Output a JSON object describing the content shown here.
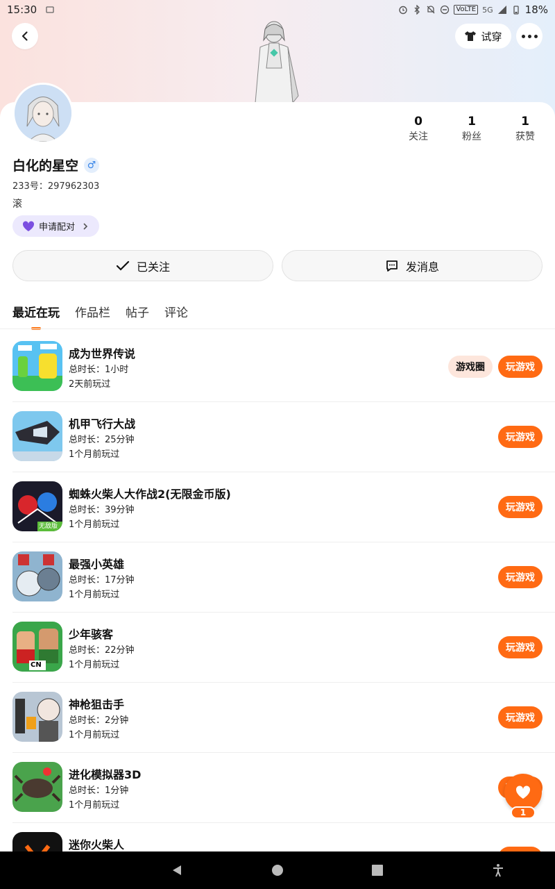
{
  "status_bar": {
    "time": "15:30",
    "network": "5G",
    "volte": "VoLTE",
    "battery": "18%"
  },
  "header": {
    "tryon_label": "试穿"
  },
  "profile": {
    "name": "白化的星空",
    "gender_symbol": "♂",
    "uid": "233号：297962303",
    "bio": "滚",
    "match_label": "申请配对",
    "stats": [
      {
        "value": "0",
        "label": "关注"
      },
      {
        "value": "1",
        "label": "粉丝"
      },
      {
        "value": "1",
        "label": "获赞"
      }
    ]
  },
  "actions": {
    "follow_label": "已关注",
    "message_label": "发消息"
  },
  "tabs": [
    "最近在玩",
    "作品栏",
    "帖子",
    "评论"
  ],
  "games": [
    {
      "title": "成为世界传说",
      "duration": "总时长：1小时",
      "last": "2天前玩过",
      "circle": "游戏圈",
      "play": "玩游戏"
    },
    {
      "title": "机甲飞行大战",
      "duration": "总时长：25分钟",
      "last": "1个月前玩过",
      "play": "玩游戏"
    },
    {
      "title": "蜘蛛火柴人大作战2(无限金币版)",
      "duration": "总时长：39分钟",
      "last": "1个月前玩过",
      "play": "玩游戏",
      "icon_badge": "无敌版"
    },
    {
      "title": "最强小英雄",
      "duration": "总时长：17分钟",
      "last": "1个月前玩过",
      "play": "玩游戏"
    },
    {
      "title": "少年骇客",
      "duration": "总时长：22分钟",
      "last": "1个月前玩过",
      "play": "玩游戏",
      "icon_badge": "CN"
    },
    {
      "title": "神枪狙击手",
      "duration": "总时长：2分钟",
      "last": "1个月前玩过",
      "play": "玩游戏"
    },
    {
      "title": "进化模拟器3D",
      "duration": "总时长：1分钟",
      "last": "1个月前玩过",
      "play": "玩游戏"
    },
    {
      "title": "迷你火柴人",
      "duration": "",
      "last": "",
      "play": "玩游戏"
    }
  ],
  "like_fab": {
    "count": "1"
  },
  "colors": {
    "accent": "#ff6a13",
    "chip_bg": "#ece9fd"
  }
}
